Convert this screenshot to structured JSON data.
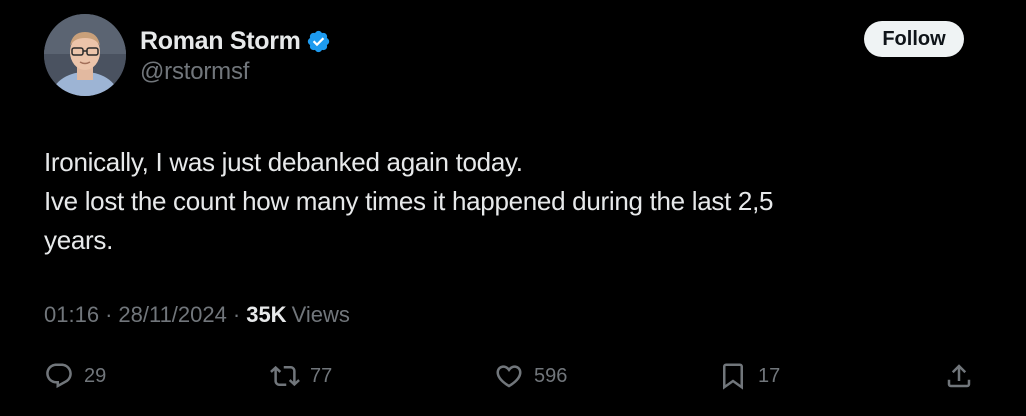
{
  "author": {
    "display_name": "Roman Storm",
    "handle": "@rstormsf",
    "verified": true
  },
  "follow_button": {
    "label": "Follow"
  },
  "tweet": {
    "text_lines": [
      "Ironically, I was just debanked again today.",
      "Ive lost the count how many times it happened during the last 2,5",
      "years."
    ],
    "time": "01:16",
    "date": "28/11/2024",
    "separator": "·",
    "views_count": "35K",
    "views_label": "Views"
  },
  "actions": {
    "replies": "29",
    "reposts": "77",
    "likes": "596",
    "bookmarks": "17"
  },
  "icons": {
    "reply": "reply-bubble-icon",
    "repost": "repost-icon",
    "like": "heart-icon",
    "bookmark": "bookmark-icon",
    "share": "share-icon",
    "verified": "verified-badge-icon"
  },
  "colors": {
    "background": "#000000",
    "text_primary": "#e7e9ea",
    "text_secondary": "#71767b",
    "verified_blue": "#1d9bf0",
    "follow_bg": "#eff3f4"
  }
}
